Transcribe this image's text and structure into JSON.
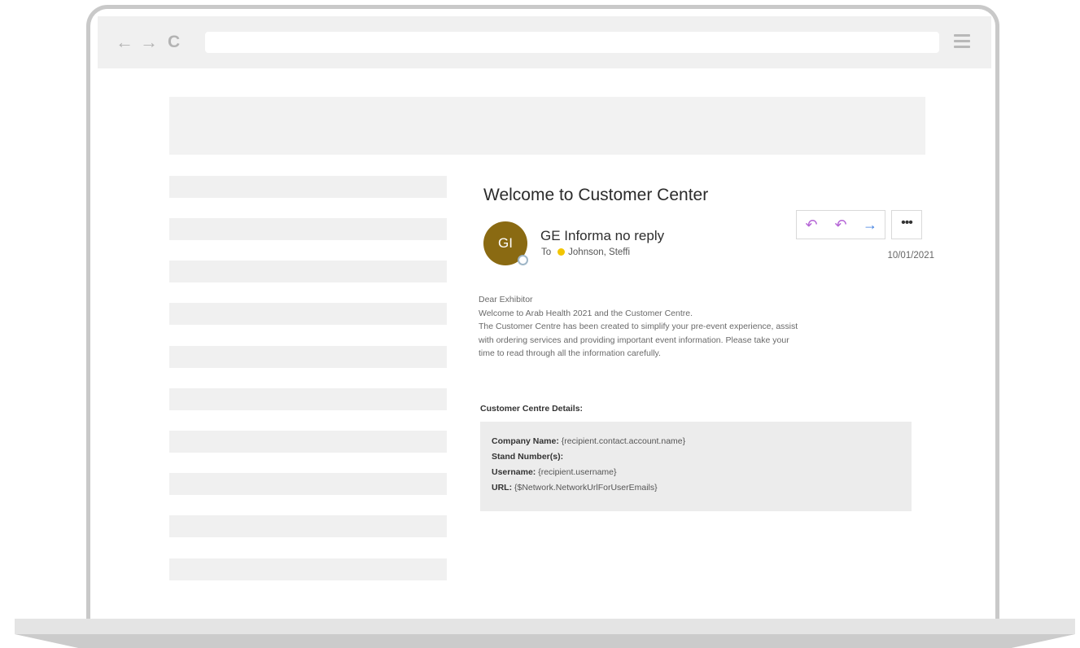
{
  "browser": {
    "back_icon": "←",
    "forward_icon": "→",
    "reload_icon": "C"
  },
  "email": {
    "subject": "Welcome to Customer Center",
    "avatar_initials": "GI",
    "avatar_color": "#8a6a12",
    "sender": "GE Informa no reply",
    "to_label": "To",
    "recipient": "Johnson, Steffi",
    "date": "10/01/2021",
    "actions": {
      "reply_icon": "↶",
      "reply_all_icon": "↶",
      "forward_icon": "→",
      "more_icon": "•••"
    },
    "body_lines": [
      "Dear Exhibitor",
      "Welcome to Arab Health 2021 and the Customer Centre.",
      "The Customer Centre has been created to simplify your pre-event experience, assist",
      "with ordering services and providing important event information. Please take your",
      "time to read through all the information carefully."
    ],
    "details_title": "Customer Centre Details:",
    "details": [
      {
        "label": "Company Name:",
        "value": " {recipient.contact.account.name}"
      },
      {
        "label": "Stand Number(s):",
        "value": ""
      },
      {
        "label": "Username:",
        "value": " {recipient.username}"
      },
      {
        "label": "URL:",
        "value": " {$Network.NetworkUrlForUserEmails}"
      }
    ]
  }
}
